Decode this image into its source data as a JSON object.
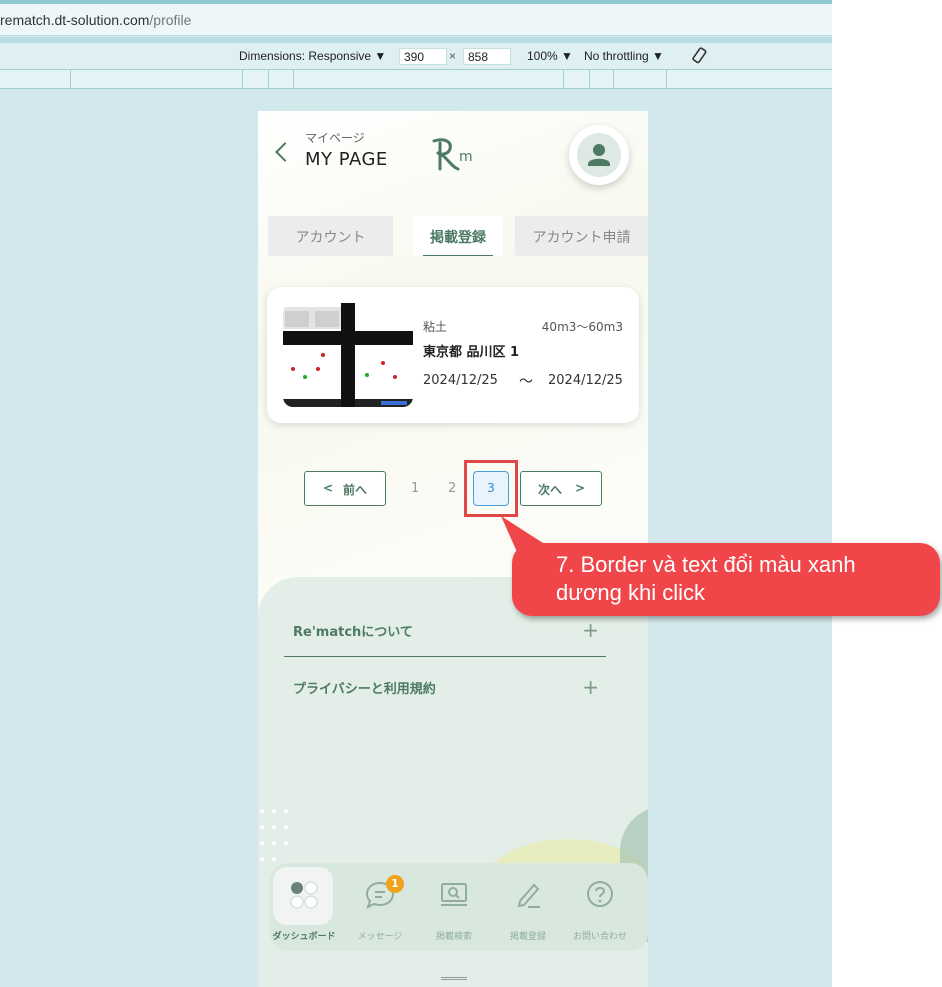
{
  "browser": {
    "url_host": "rematch.dt-solution.com",
    "url_path": "/profile",
    "devtools": {
      "dimensions_label": "Dimensions: Responsive",
      "width": "390",
      "height": "858",
      "times": "×",
      "zoom": "100%",
      "throttling": "No throttling"
    }
  },
  "header": {
    "subtitle": "マイページ",
    "title": "MY PAGE",
    "logo_text": "Rm"
  },
  "tabs": [
    {
      "label": "アカウント",
      "active": false
    },
    {
      "label": "掲載登録",
      "active": true
    },
    {
      "label": "アカウント申請",
      "active": false
    }
  ],
  "listing": {
    "material": "粘土",
    "volume": "40m3〜60m3",
    "location": "東京都 品川区 1",
    "date_from": "2024/12/25",
    "tilde": "〜",
    "date_to": "2024/12/25"
  },
  "pagination": {
    "prev_label": "前へ",
    "next_label": "次へ",
    "pages": [
      "1",
      "2",
      "3"
    ],
    "current": "3"
  },
  "footer": {
    "items": [
      {
        "label": "Re'matchについて"
      },
      {
        "label": "プライバシーと利用規約"
      }
    ],
    "plus": "+"
  },
  "bottom_nav": [
    {
      "label": "ダッシュボード",
      "icon": "dashboard-icon",
      "active": true
    },
    {
      "label": "メッセージ",
      "icon": "message-icon",
      "badge": "1"
    },
    {
      "label": "掲載検索",
      "icon": "search-listing-icon"
    },
    {
      "label": "掲載登録",
      "icon": "pen-icon"
    },
    {
      "label": "お問い合わせ",
      "icon": "question-icon"
    }
  ],
  "annotation": {
    "line1": "7. Border và text đổi màu xanh",
    "line2": "dương khi click"
  },
  "colors": {
    "brand_green": "#4d7a63",
    "active_blue": "#2d8bd0",
    "badge_orange": "#f0a21b",
    "annotation_red": "#f0464a"
  }
}
